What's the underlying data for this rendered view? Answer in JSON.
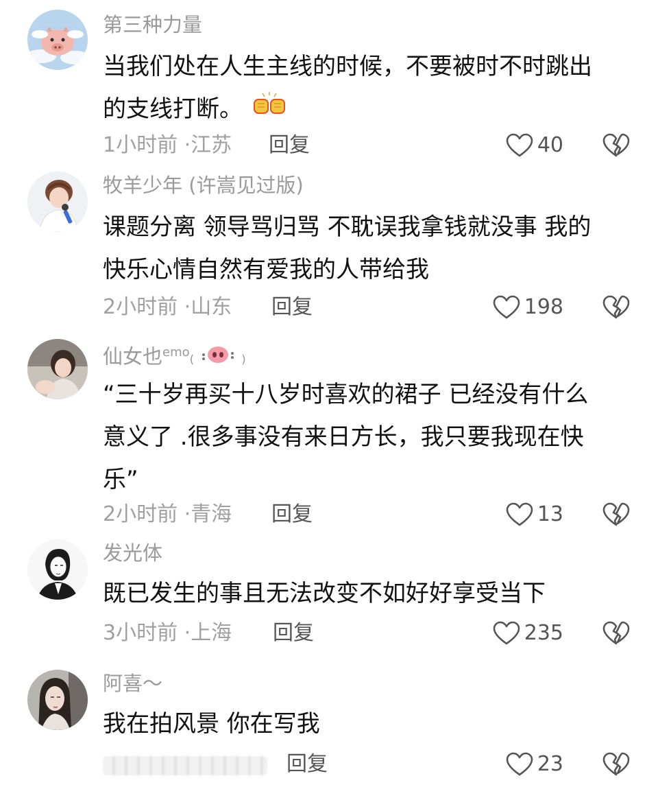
{
  "comments": [
    {
      "username": "第三种力量",
      "lines": [
        "当我们处在人生主线的时候，不要被时不时跳出",
        "的支线打断。"
      ],
      "time": "1小时前",
      "location": "江苏",
      "reply": "回复",
      "likes": "40",
      "avatar_icon": "flying-pig-avatar"
    },
    {
      "username": "牧羊少年 (许嵩见过版)",
      "lines": [
        "课题分离 领导骂归骂 不耽误我拿钱就没事 我的",
        "快乐心情自然有爱我的人带给我"
      ],
      "time": "2小时前",
      "location": "山东",
      "reply": "回复",
      "likes": "198",
      "avatar_icon": "singer-avatar"
    },
    {
      "username": "仙女也",
      "username_sup": "emo",
      "username_suffix": "( ",
      "username_suffix_end": " )",
      "lines": [
        "“三十岁再买十八岁时喜欢的裙子 已经没有什么",
        "意义了 .很多事没有来日方长，我只要我现在快",
        "乐”"
      ],
      "time": "2小时前",
      "location": "青海",
      "reply": "回复",
      "likes": "13",
      "avatar_icon": "girl-avatar"
    },
    {
      "username": "发光体",
      "lines": [
        "既已发生的事且无法改变不如好好享受当下"
      ],
      "time": "3小时前",
      "location": "上海",
      "reply": "回复",
      "likes": "235",
      "avatar_icon": "sketch-person-avatar"
    },
    {
      "username": "阿喜～",
      "lines": [
        "我在拍风景 你在写我"
      ],
      "time": "",
      "location": "",
      "reply": "回复",
      "likes": "23",
      "avatar_icon": "woman-portrait-avatar"
    }
  ],
  "separator": "·",
  "icons": {
    "like": "heart-outline-icon",
    "dislike": "broken-heart-icon",
    "emoji_comment1": "fist-bump-emoji",
    "emoji_username3": "pig-nose-emoji"
  },
  "colors": {
    "username": "#9a9a9a",
    "body": "#111111",
    "meta": "#a0a0a0",
    "action": "#555555"
  }
}
